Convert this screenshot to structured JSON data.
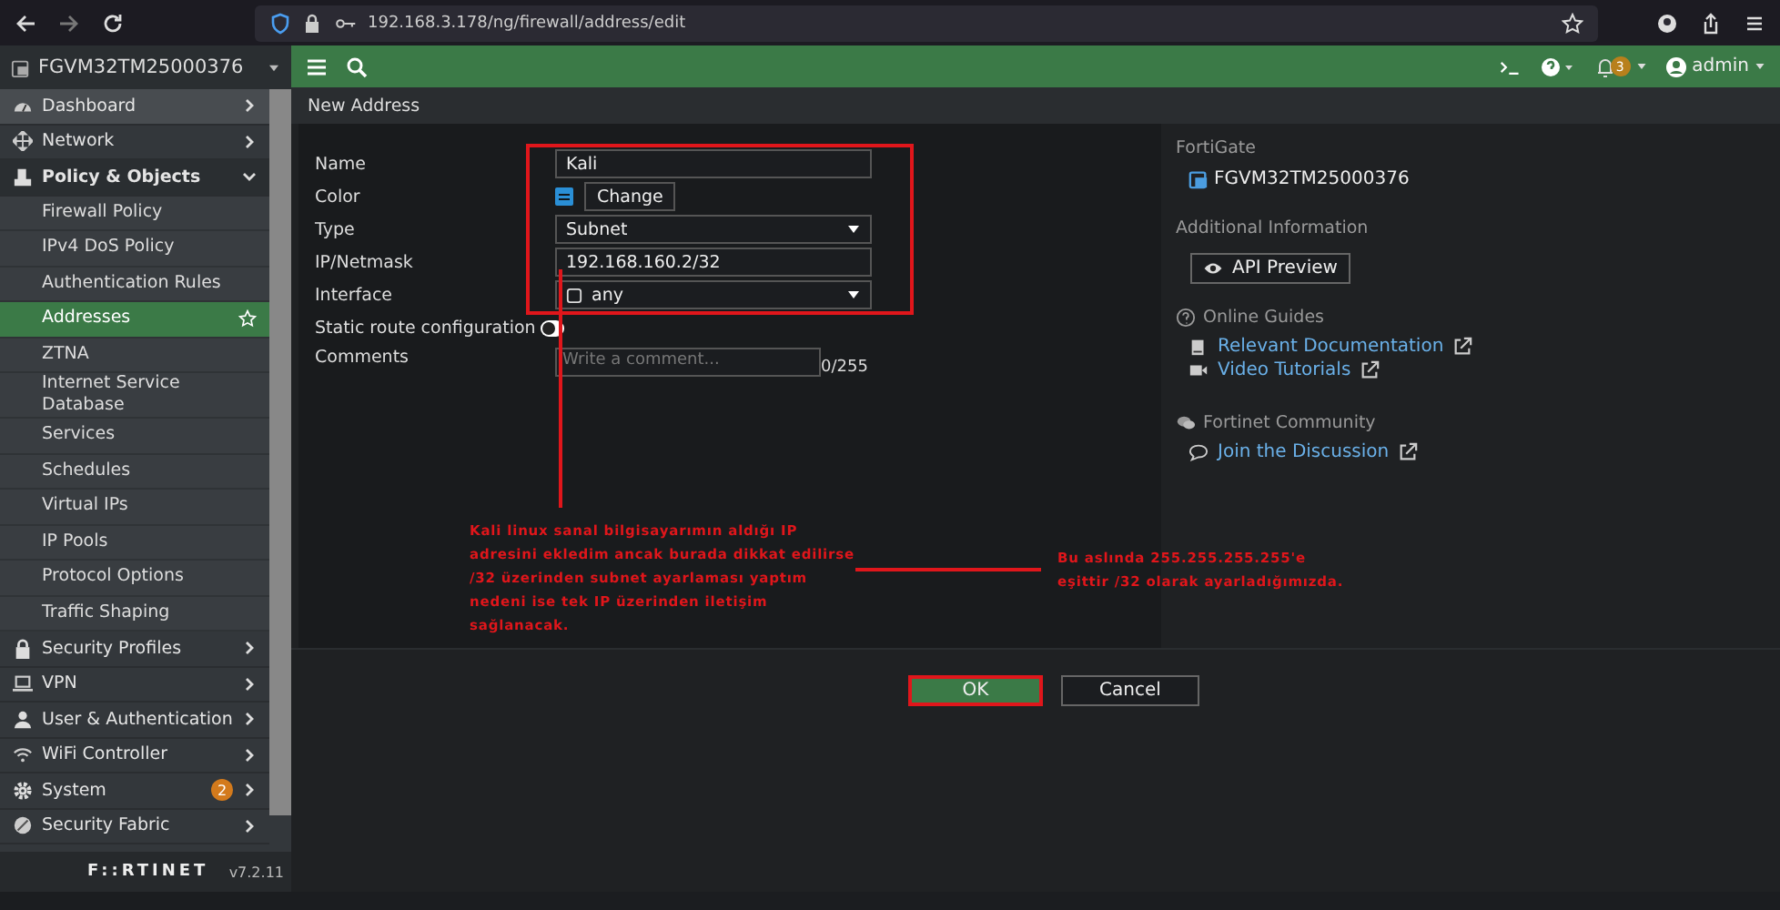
{
  "browser": {
    "url": "192.168.3.178/ng/firewall/address/edit"
  },
  "sidebar": {
    "device": "FGVM32TM25000376",
    "items": [
      {
        "label": "Dashboard",
        "expanded": false,
        "selected": false
      },
      {
        "label": "Network",
        "expanded": false,
        "selected": false
      },
      {
        "label": "Policy & Objects",
        "expanded": true,
        "selected": false,
        "children": [
          {
            "label": "Firewall Policy",
            "selected": false
          },
          {
            "label": "IPv4 DoS Policy",
            "selected": false
          },
          {
            "label": "Authentication Rules",
            "selected": false
          },
          {
            "label": "Addresses",
            "selected": true
          },
          {
            "label": "ZTNA",
            "selected": false
          },
          {
            "label": "Internet Service Database",
            "selected": false
          },
          {
            "label": "Services",
            "selected": false
          },
          {
            "label": "Schedules",
            "selected": false
          },
          {
            "label": "Virtual IPs",
            "selected": false
          },
          {
            "label": "IP Pools",
            "selected": false
          },
          {
            "label": "Protocol Options",
            "selected": false
          },
          {
            "label": "Traffic Shaping",
            "selected": false
          }
        ]
      },
      {
        "label": "Security Profiles",
        "expanded": false,
        "selected": false
      },
      {
        "label": "VPN",
        "expanded": false,
        "selected": false
      },
      {
        "label": "User & Authentication",
        "expanded": false,
        "selected": false
      },
      {
        "label": "WiFi Controller",
        "expanded": false,
        "selected": false
      },
      {
        "label": "System",
        "expanded": false,
        "selected": false,
        "badge": "2"
      },
      {
        "label": "Security Fabric",
        "expanded": false,
        "selected": false
      }
    ],
    "brand": "F::RTINET",
    "version": "v7.2.11"
  },
  "header": {
    "notifications": "3",
    "user": "admin"
  },
  "breadcrumb": "New Address",
  "form": {
    "name_label": "Name",
    "name": "Kali",
    "color_label": "Color",
    "color": "#2a8fd6",
    "change_button": "Change",
    "type_label": "Type",
    "type": "Subnet",
    "ip_label": "IP/Netmask",
    "ip": "192.168.160.2/32",
    "interface_label": "Interface",
    "interface": "any",
    "static_route_label": "Static route configuration",
    "static_route": false,
    "comments_label": "Comments",
    "comments_placeholder": "Write a comment...",
    "comments_count": "0/255"
  },
  "info": {
    "fortigate_title": "FortiGate",
    "device": "FGVM32TM25000376",
    "additional_title": "Additional Information",
    "api_button": "API Preview",
    "guides_title": "Online Guides",
    "doc_link": "Relevant Documentation",
    "video_link": "Video Tutorials",
    "community_title": "Fortinet Community",
    "discussion_link": "Join the Discussion"
  },
  "buttons": {
    "ok": "OK",
    "cancel": "Cancel"
  },
  "annotations": [
    {
      "text": "Kali linux sanal bilgisayarımın aldığı IP adresini ekledim ancak burada dikkat edilirse /32 üzerinden subnet ayarlaması yaptım nedeni ise tek IP üzerinden iletişim sağlanacak."
    },
    {
      "text": "Bu aslında 255.255.255.255'e eşittir /32 olarak ayarladığımızda."
    }
  ]
}
